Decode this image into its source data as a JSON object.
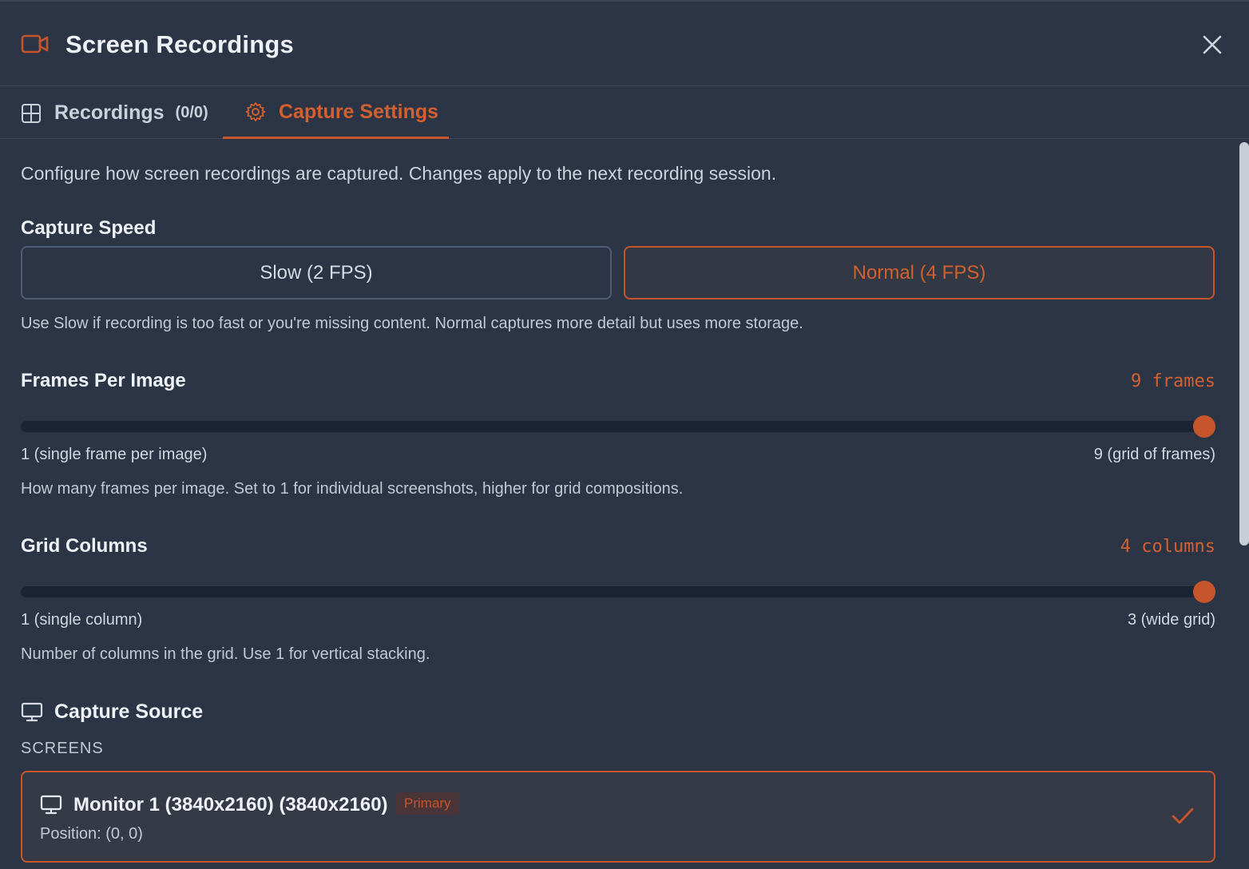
{
  "header": {
    "title": "Screen Recordings"
  },
  "tabs": {
    "recordings": {
      "label": "Recordings",
      "count": "(0/0)"
    },
    "capture_settings": {
      "label": "Capture Settings"
    }
  },
  "description": "Configure how screen recordings are captured. Changes apply to the next recording session.",
  "capture_speed": {
    "title": "Capture Speed",
    "options": [
      "Slow (2 FPS)",
      "Normal (4 FPS)"
    ],
    "selected": "Normal (4 FPS)",
    "help": "Use Slow if recording is too fast or you're missing content. Normal captures more detail but uses more storage."
  },
  "frames_per_image": {
    "title": "Frames Per Image",
    "value_label": "9 frames",
    "min_label": "1 (single frame per image)",
    "max_label": "9 (grid of frames)",
    "value": 9,
    "min": 1,
    "max": 9,
    "help": "How many frames per image. Set to 1 for individual screenshots, higher for grid compositions."
  },
  "grid_columns": {
    "title": "Grid Columns",
    "value_label": "4 columns",
    "min_label": "1 (single column)",
    "max_label": "3 (wide grid)",
    "slider_fraction": 1.0,
    "help": "Number of columns in the grid. Use 1 for vertical stacking."
  },
  "capture_source": {
    "title": "Capture Source",
    "screens_label": "SCREENS",
    "monitors": [
      {
        "name": "Monitor 1 (3840x2160) (3840x2160)",
        "badge": "Primary",
        "position": "Position: (0, 0)",
        "selected": true
      }
    ]
  },
  "colors": {
    "accent": "#c6552c",
    "background": "#2b3546",
    "track": "#1c2433"
  },
  "icons": [
    "video-camera-icon",
    "close-icon",
    "grid-icon",
    "gear-icon",
    "monitor-icon",
    "checkmark-icon"
  ]
}
